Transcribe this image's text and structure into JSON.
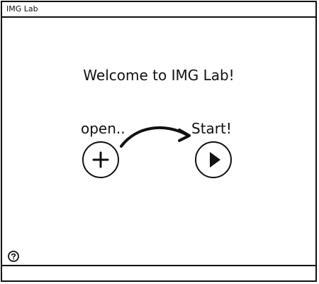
{
  "window": {
    "title": "IMG Lab"
  },
  "main": {
    "welcome_text": "Welcome to IMG Lab!",
    "open_label": "open..",
    "start_label": "Start!"
  },
  "icons": {
    "open": "plus-icon",
    "start": "play-icon",
    "flow": "curved-arrow-icon",
    "help": "question-mark-icon"
  },
  "colors": {
    "ink": "#111111",
    "background": "#ffffff"
  }
}
